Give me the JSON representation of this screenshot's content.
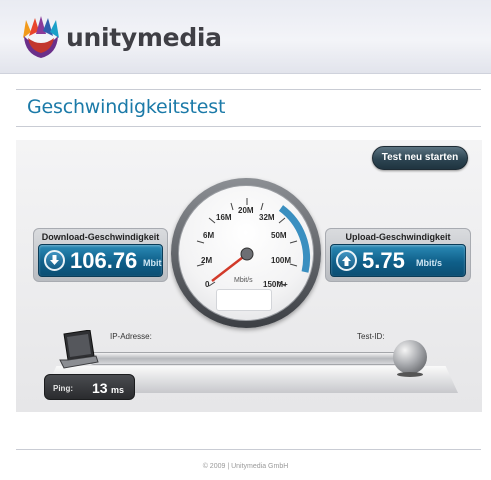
{
  "brand": {
    "name": "unitymedia"
  },
  "page": {
    "title": "Geschwindigkeitstest"
  },
  "toolbar": {
    "restart_label": "Test neu starten"
  },
  "download": {
    "label": "Download-Geschwindigkeit",
    "value": "106.76",
    "unit": "Mbit"
  },
  "upload": {
    "label": "Upload-Geschwindigkeit",
    "value": "5.75",
    "unit": "Mbit/s"
  },
  "gauge": {
    "ticks": [
      "0",
      "2M",
      "6M",
      "16M",
      "20M",
      "32M",
      "50M",
      "100M",
      "150M+"
    ],
    "unit": "Mbit/s",
    "needle_value_label": "2M"
  },
  "connection": {
    "ip_label": "IP-Adresse:",
    "test_id_label": "Test-ID:"
  },
  "ping": {
    "label": "Ping:",
    "value": "13",
    "unit": "ms"
  },
  "footer": {
    "text": "© 2009 | Unitymedia GmbH"
  },
  "icons": {
    "logo": "unitymedia-logo-icon",
    "download": "arrow-down-icon",
    "upload": "arrow-up-icon",
    "client": "laptop-icon",
    "server": "globe-icon"
  },
  "colors": {
    "accent": "#1b7aa8",
    "value_box": "#0f5f89",
    "gauge_arc": "#3a8fc0"
  }
}
